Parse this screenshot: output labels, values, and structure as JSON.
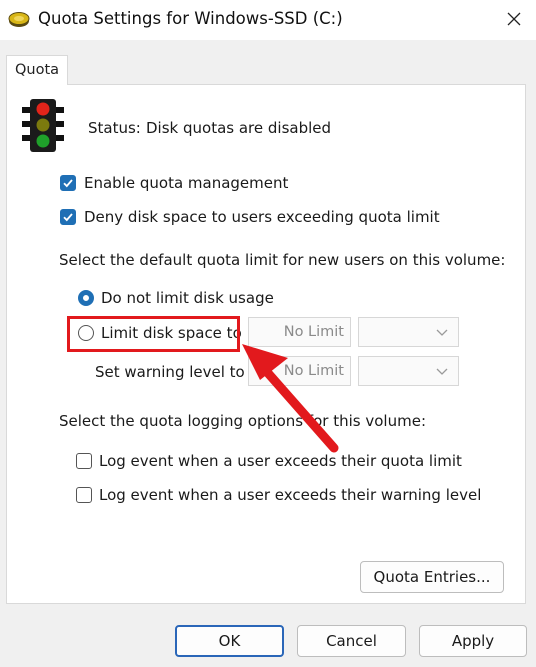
{
  "window": {
    "title": "Quota Settings for Windows-SSD (C:)",
    "close_symbol": "✕"
  },
  "tabs": [
    {
      "label": "Quota",
      "active": true
    }
  ],
  "status": {
    "label": "Status:",
    "value": "Disk quotas are disabled",
    "icon": "traffic-light-icon"
  },
  "options": {
    "enable_quota": {
      "label": "Enable quota management",
      "checked": true
    },
    "deny_space": {
      "label": "Deny disk space to users exceeding quota limit",
      "checked": true
    }
  },
  "default_limit": {
    "heading": "Select the default quota limit for new users on this volume:",
    "no_limit_radio": {
      "label": "Do not limit disk usage",
      "selected": true
    },
    "limit_radio": {
      "label": "Limit disk space to",
      "selected": false
    },
    "limit_value": "No Limit",
    "warning_label": "Set warning level to",
    "warning_value": "No Limit"
  },
  "logging": {
    "heading": "Select the quota logging options for this volume:",
    "exceed_limit": {
      "label": "Log event when a user exceeds their quota limit",
      "checked": false
    },
    "exceed_warning": {
      "label": "Log event when a user exceeds their warning level",
      "checked": false
    }
  },
  "buttons": {
    "quota_entries": "Quota Entries...",
    "ok": "OK",
    "cancel": "Cancel",
    "apply": "Apply"
  },
  "colors": {
    "accent": "#1f6fb5",
    "annotation_red": "#e2191d"
  }
}
